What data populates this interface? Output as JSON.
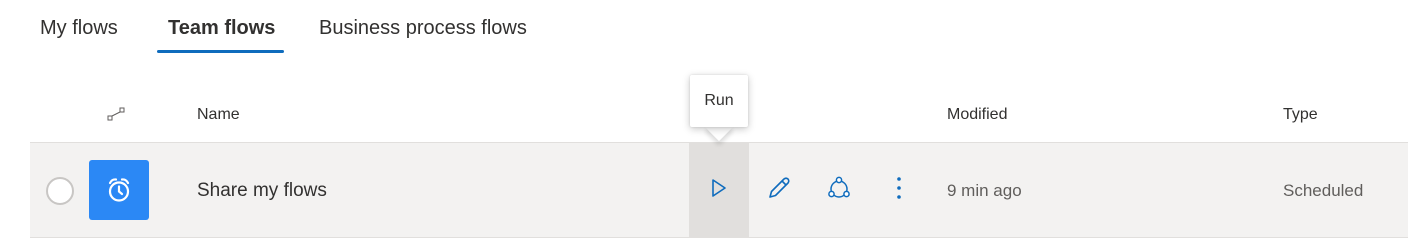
{
  "tabs": {
    "my_flows": "My flows",
    "team_flows": "Team flows",
    "business_process_flows": "Business process flows",
    "active": "Team flows"
  },
  "table": {
    "headers": {
      "type_icon": "flow-type-icon",
      "name": "Name",
      "modified": "Modified",
      "type": "Type"
    },
    "rows": [
      {
        "icon": "alarm-clock-icon",
        "name": "Share my flows",
        "modified": "9 min ago",
        "type": "Scheduled",
        "actions": [
          "run-icon",
          "edit-icon",
          "share-icon",
          "more-icon"
        ]
      }
    ]
  },
  "tooltip": {
    "text": "Run"
  },
  "colors": {
    "accent": "#0f6cbd",
    "flow_icon_bg": "#2b88f5",
    "row_bg": "#f3f2f1",
    "hover_bg": "#e1dfdd"
  }
}
